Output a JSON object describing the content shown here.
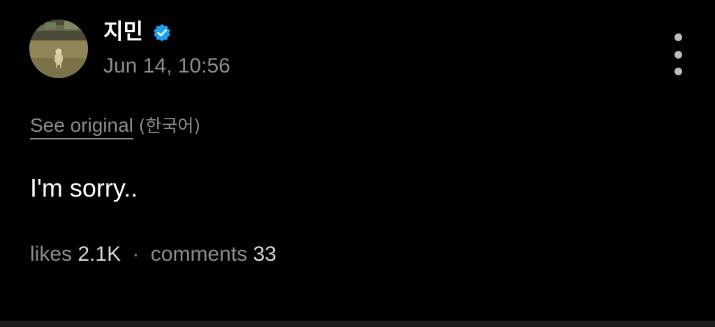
{
  "post": {
    "author": {
      "name": "지민",
      "verified": true,
      "verified_color": "#1da1f2",
      "avatar_icon": "dog-photo-avatar"
    },
    "timestamp": "Jun 14, 10:56",
    "menu_icon": "more-vertical-icon",
    "translation": {
      "link_label": "See original",
      "language": "(한국어)"
    },
    "text": "I'm sorry..",
    "stats": {
      "likes_label": "likes",
      "likes_count": "2.1K",
      "separator": "·",
      "comments_label": "comments",
      "comments_count": "33"
    }
  },
  "colors": {
    "background": "#000000",
    "primary_text": "#ffffff",
    "secondary_text": "#8c8c8c",
    "bottom_bar": "#1c1c1e"
  }
}
